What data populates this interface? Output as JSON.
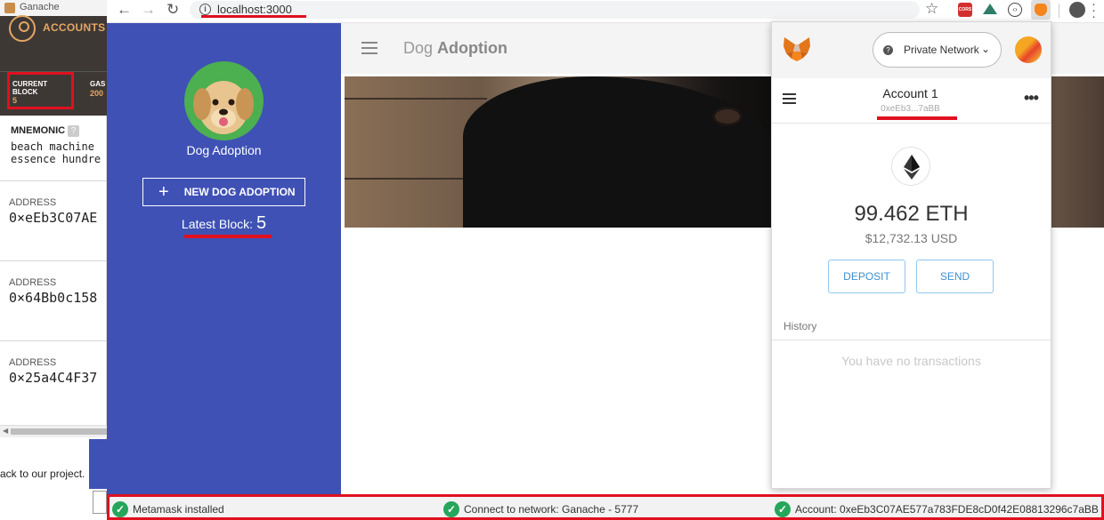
{
  "ganache": {
    "title": "Ganache",
    "accounts_label": "ACCOUNTS",
    "current_block_label": "CURRENT BLOCK",
    "current_block_value": "5",
    "gas_label": "GAS",
    "gas_value": "200",
    "mnemonic_label": "MNEMONIC",
    "mnemonic_help": "?",
    "mnemonic_line1": "beach machine",
    "mnemonic_line2": "essence hundre",
    "addresses": [
      {
        "label": "ADDRESS",
        "value": "0×eEb3C07AE"
      },
      {
        "label": "ADDRESS",
        "value": "0×64Bb0c158"
      },
      {
        "label": "ADDRESS",
        "value": "0×25a4C4F37"
      }
    ]
  },
  "doc_behind": {
    "text": "ack to our project."
  },
  "browser": {
    "url": "localhost:3000"
  },
  "dapp": {
    "title_prefix": "Dog",
    "title_suffix": "Adoption",
    "sidebar_name": "Dog Adoption",
    "new_dog_button": "NEW DOG ADOPTION",
    "latest_block_label": "Latest Block:",
    "latest_block_value": "5"
  },
  "metamask": {
    "network": "Private Network",
    "account_name": "Account 1",
    "account_address_short": "0xeEb3...7aBB",
    "balance_eth": "99.462 ETH",
    "balance_usd": "$12,732.13 USD",
    "deposit_label": "DEPOSIT",
    "send_label": "SEND",
    "history_label": "History",
    "no_transactions": "You have no transactions"
  },
  "status": {
    "metamask": "Metamask installed",
    "network": "Connect to network: Ganache - 5777",
    "account": "Account: 0xeEb3C07AE577a783FDE8cD0f42E08813296c7aBB"
  },
  "colors": {
    "highlight_red": "#e0101f",
    "dapp_primary": "#3f51b5",
    "ganache_accent": "#e4a663",
    "metamask_blue": "#3f8fd1",
    "success_green": "#26a65b"
  }
}
